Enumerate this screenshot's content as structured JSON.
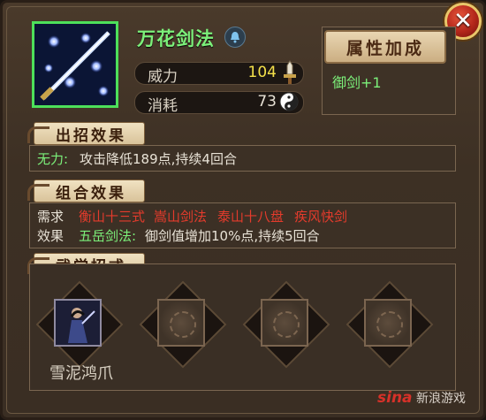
{
  "skill": {
    "name": "万花剑法",
    "stats": [
      {
        "label": "威力",
        "value": "104",
        "icon": "sword-icon"
      },
      {
        "label": "消耗",
        "value": "73",
        "icon": "yin-yang-icon"
      }
    ]
  },
  "attribute": {
    "button_label": "属性加成",
    "bonus": "御剑+1"
  },
  "effect_section": {
    "header": "出招效果",
    "name": "无力:",
    "text": "攻击降低189点,持续4回合"
  },
  "combo_section": {
    "header": "组合效果",
    "require_label": "需求",
    "requirements": [
      "衡山十三式",
      "嵩山剑法",
      "泰山十八盘",
      "疾风快剑"
    ],
    "effect_label": "效果",
    "effect_name": "五岳剑法:",
    "effect_text": "御剑值增加10%点,持续5回合"
  },
  "moves_section": {
    "header": "武学招式",
    "moves": [
      {
        "label": "雪泥鸿爪",
        "unlocked": true
      },
      {
        "label": "",
        "unlocked": false
      },
      {
        "label": "",
        "unlocked": false
      },
      {
        "label": "",
        "unlocked": false
      }
    ]
  },
  "close_button": {
    "label": "✕"
  },
  "watermark": {
    "brand": "sina",
    "text": "新浪游戏"
  },
  "colors": {
    "accent_green": "#7cf07a",
    "requirement_red": "#e43b2c",
    "power_yellow": "#f4e04a"
  }
}
